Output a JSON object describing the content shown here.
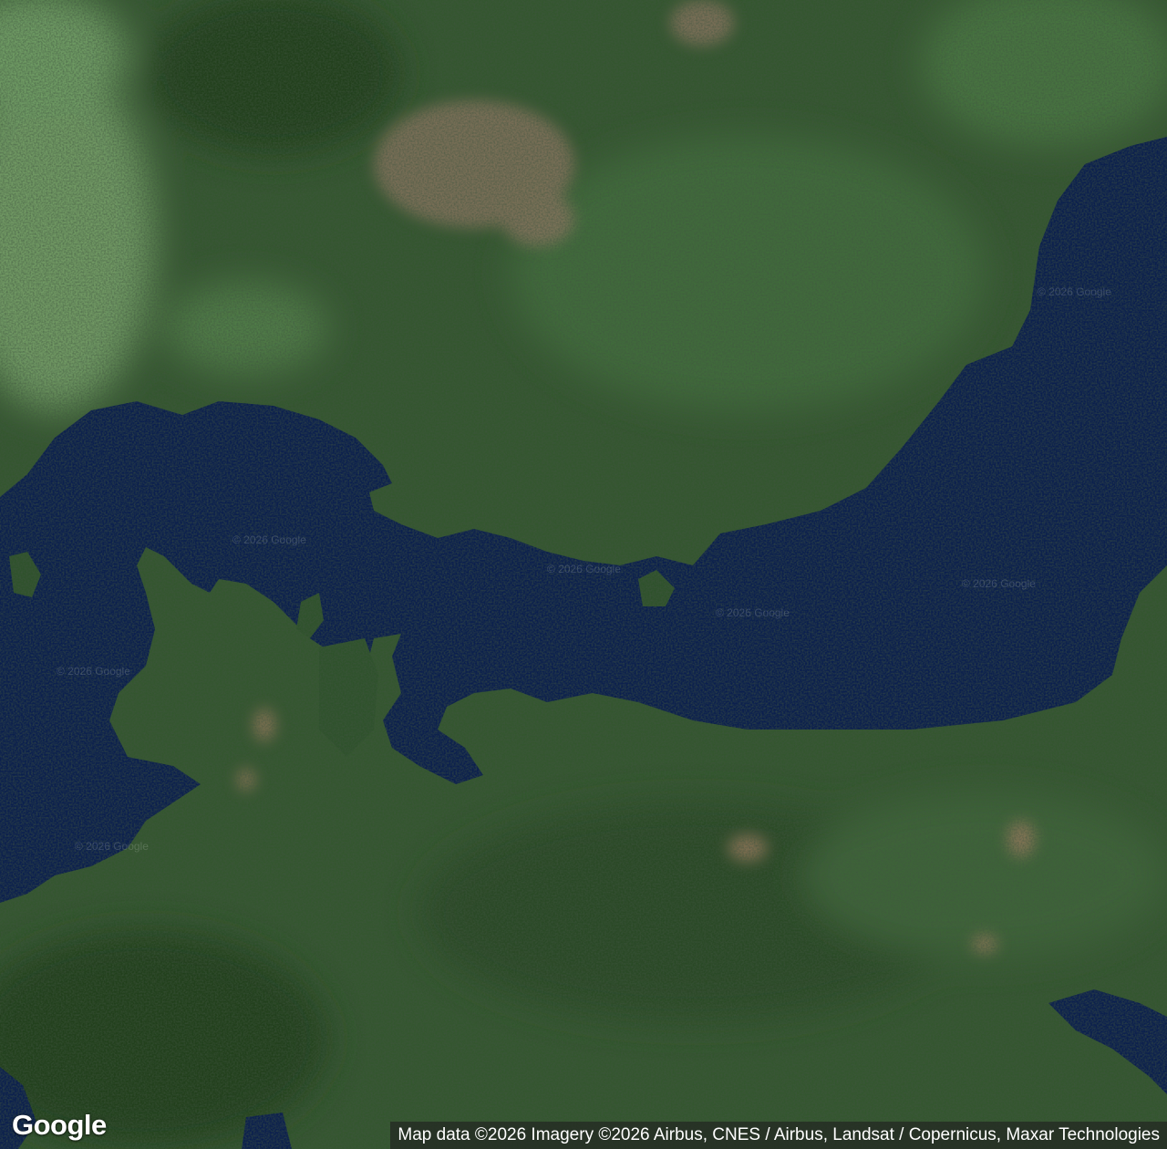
{
  "map": {
    "type": "satellite",
    "colors": {
      "water": "#0b1f4e",
      "forest": "#2e4f2c",
      "light_forest": "#5f8b56",
      "clearcut": "#9a7a5f"
    },
    "watermarks": [
      "© 2026 Google",
      "© 2026 Google",
      "© 2026 Google",
      "© 2026 Google",
      "© 2026 Google",
      "© 2026 Google",
      "© 2026 Google"
    ]
  },
  "logo": "Google",
  "attribution": "Map data ©2026 Imagery ©2026 Airbus, CNES / Airbus, Landsat / Copernicus, Maxar Technologies"
}
